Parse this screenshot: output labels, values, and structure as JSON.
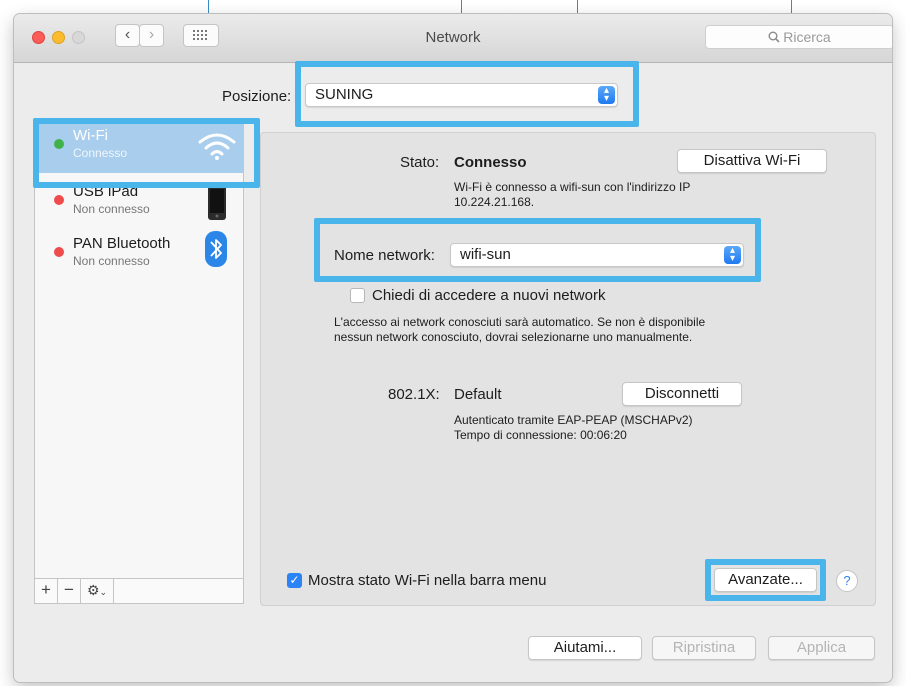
{
  "window": {
    "title": "Network"
  },
  "search": {
    "placeholder": "Ricerca",
    "icon": "magnifier-icon"
  },
  "location": {
    "label": "Posizione:",
    "value": "SUNING"
  },
  "sidebar": {
    "items": [
      {
        "name": "Wi-Fi",
        "status": "Connesso",
        "status_color": "#3fb34a",
        "icon": "wifi-icon"
      },
      {
        "name": "USB iPad",
        "status": "Non connesso",
        "status_color": "#ef4b4b",
        "icon": "ipad-icon"
      },
      {
        "name": "PAN Bluetooth",
        "status": "Non connesso",
        "status_color": "#ef4b4b",
        "icon": "bluetooth-icon"
      }
    ],
    "toolbar": {
      "add": "+",
      "remove": "−",
      "gear": "⚙"
    }
  },
  "detail": {
    "status_label": "Stato:",
    "status_value": "Connesso",
    "toggle_button": "Disattiva Wi-Fi",
    "status_desc_1": "Wi-Fi è connesso a wifi-sun con l'indirizzo IP",
    "status_desc_2": "10.224.21.168.",
    "network_label": "Nome network:",
    "network_value": "wifi-sun",
    "ask_checkbox": "Chiedi di accedere a nuovi network",
    "ask_desc_1": "L'accesso ai network conosciuti sarà automatico. Se non è disponibile",
    "ask_desc_2": "nessun network conosciuto, dovrai selezionarne uno manualmente.",
    "dot1x_label": "802.1X:",
    "dot1x_value": "Default",
    "disconnect_button": "Disconnetti",
    "auth_desc": "Autenticato tramite EAP-PEAP (MSCHAPv2)",
    "connection_time": "Tempo di connessione: 00:06:20",
    "show_status_checkbox": "Mostra stato Wi-Fi nella barra menu",
    "advanced_button": "Avanzate...",
    "help": "?"
  },
  "footer": {
    "assist": "Aiutami...",
    "revert": "Ripristina",
    "apply": "Applica"
  },
  "colors": {
    "accent": "#2b84f5",
    "highlight": "#49b5ea"
  }
}
